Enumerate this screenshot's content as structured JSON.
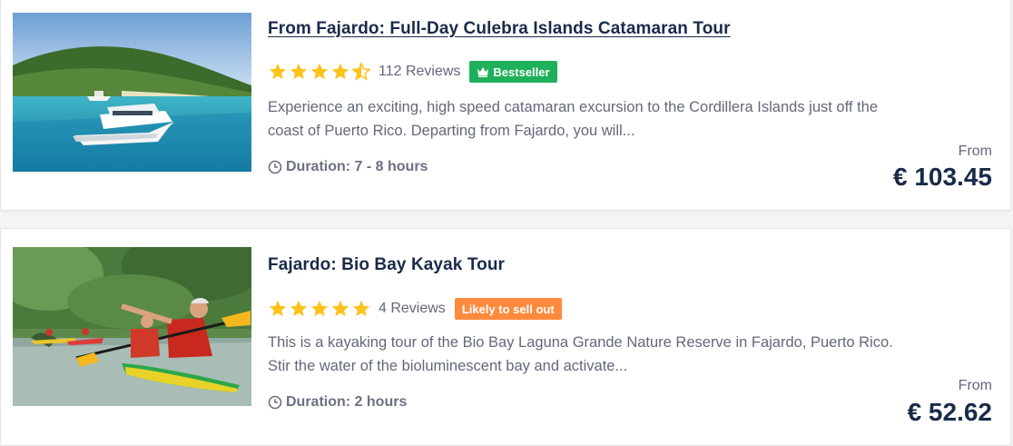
{
  "colors": {
    "title": "#1a2b49",
    "body_text": "#63687a",
    "star": "#ffc21a",
    "bestseller_badge": "#1eb05a",
    "likely_sell_out_badge": "#ff8a3d"
  },
  "tours": [
    {
      "title": "From Fajardo: Full-Day Culebra Islands Catamaran Tour",
      "rating": 4.5,
      "reviews": "112 Reviews",
      "badge": {
        "label": "Bestseller",
        "icon": "crown-icon"
      },
      "description_line1": "Experience an exciting, high speed catamaran excursion to the Cordillera Islands just off the",
      "description_line2": "coast of Puerto Rico. Departing from Fajardo, you will...",
      "duration": "Duration: 7 - 8 hours",
      "from_label": "From",
      "price": "€ 103.45"
    },
    {
      "title": "Fajardo: Bio Bay Kayak Tour",
      "rating": 5,
      "reviews": "4 Reviews",
      "badge": {
        "label": "Likely to sell out"
      },
      "description_line1": "This is a kayaking tour of the Bio Bay Laguna Grande Nature Reserve in Fajardo, Puerto Rico.",
      "description_line2": "Stir the water of the bioluminescent bay and activate...",
      "duration": "Duration: 2 hours",
      "from_label": "From",
      "price": "€ 52.62"
    }
  ]
}
